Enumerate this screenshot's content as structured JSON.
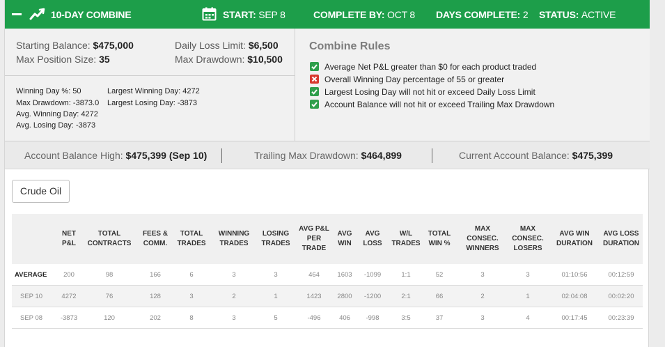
{
  "header": {
    "title": "10-DAY COMBINE",
    "start_label": "START:",
    "start_value": "SEP 8",
    "complete_label": "COMPLETE BY:",
    "complete_value": "OCT 8",
    "days_label": "DAYS COMPLETE:",
    "days_value": "2",
    "status_label": "STATUS:",
    "status_value": "ACTIVE",
    "bg_color": "#1d9e4a"
  },
  "summary": {
    "starting_balance_label": "Starting Balance:",
    "starting_balance": "$475,000",
    "max_position_label": "Max Position Size:",
    "max_position": "35",
    "daily_loss_label": "Daily Loss Limit:",
    "daily_loss": "$6,500",
    "max_drawdown_label": "Max Drawdown:",
    "max_drawdown": "$10,500"
  },
  "stats": {
    "winning_day_pct": "Winning Day %: 50",
    "max_drawdown": "Max Drawdown: -3873.0",
    "avg_winning_day": "Avg. Winning Day: 4272",
    "avg_losing_day": "Avg. Losing Day: -3873",
    "largest_winning_day": "Largest Winning Day: 4272",
    "largest_losing_day": "Largest Losing Day: -3873"
  },
  "rules": {
    "title": "Combine Rules",
    "items": [
      {
        "text": "Average Net P&L greater than $0 for each product traded",
        "status": "pass"
      },
      {
        "text": "Overall Winning Day percentage of 55 or greater",
        "status": "fail"
      },
      {
        "text": "Largest Losing Day will not hit or exceed Daily Loss Limit",
        "status": "pass"
      },
      {
        "text": "Account Balance will not hit or exceed Trailing Max Drawdown",
        "status": "pass"
      }
    ],
    "pass_color": "#2f9f4c",
    "fail_color": "#d73a2f"
  },
  "balance": {
    "high_label": "Account Balance High:",
    "high_value": "$475,399 (Sep 10)",
    "trailing_label": "Trailing Max Drawdown:",
    "trailing_value": "$464,899",
    "current_label": "Current Account Balance:",
    "current_value": "$475,399"
  },
  "product_button": "Crude Oil",
  "table": {
    "headers": [
      "",
      "NET P&L",
      "TOTAL CONTRACTS",
      "FEES & COMM.",
      "TOTAL TRADES",
      "WINNING TRADES",
      "LOSING TRADES",
      "AVG P&L PER TRADE",
      "AVG WIN",
      "AVG LOSS",
      "W/L TRADES",
      "TOTAL WIN %",
      "MAX CONSEC. WINNERS",
      "MAX CONSEC. LOSERS",
      "AVG WIN DURATION",
      "AVG LOSS DURATION"
    ],
    "rows": [
      [
        "AVERAGE",
        "200",
        "98",
        "166",
        "6",
        "3",
        "3",
        "464",
        "1603",
        "-1099",
        "1:1",
        "52",
        "3",
        "3",
        "01:10:56",
        "00:12:59"
      ],
      [
        "SEP 10",
        "4272",
        "76",
        "128",
        "3",
        "2",
        "1",
        "1423",
        "2800",
        "-1200",
        "2:1",
        "66",
        "2",
        "1",
        "02:04:08",
        "00:02:20"
      ],
      [
        "SEP 08",
        "-3873",
        "120",
        "202",
        "8",
        "3",
        "5",
        "-496",
        "406",
        "-998",
        "3:5",
        "37",
        "3",
        "4",
        "00:17:45",
        "00:23:39"
      ]
    ]
  }
}
